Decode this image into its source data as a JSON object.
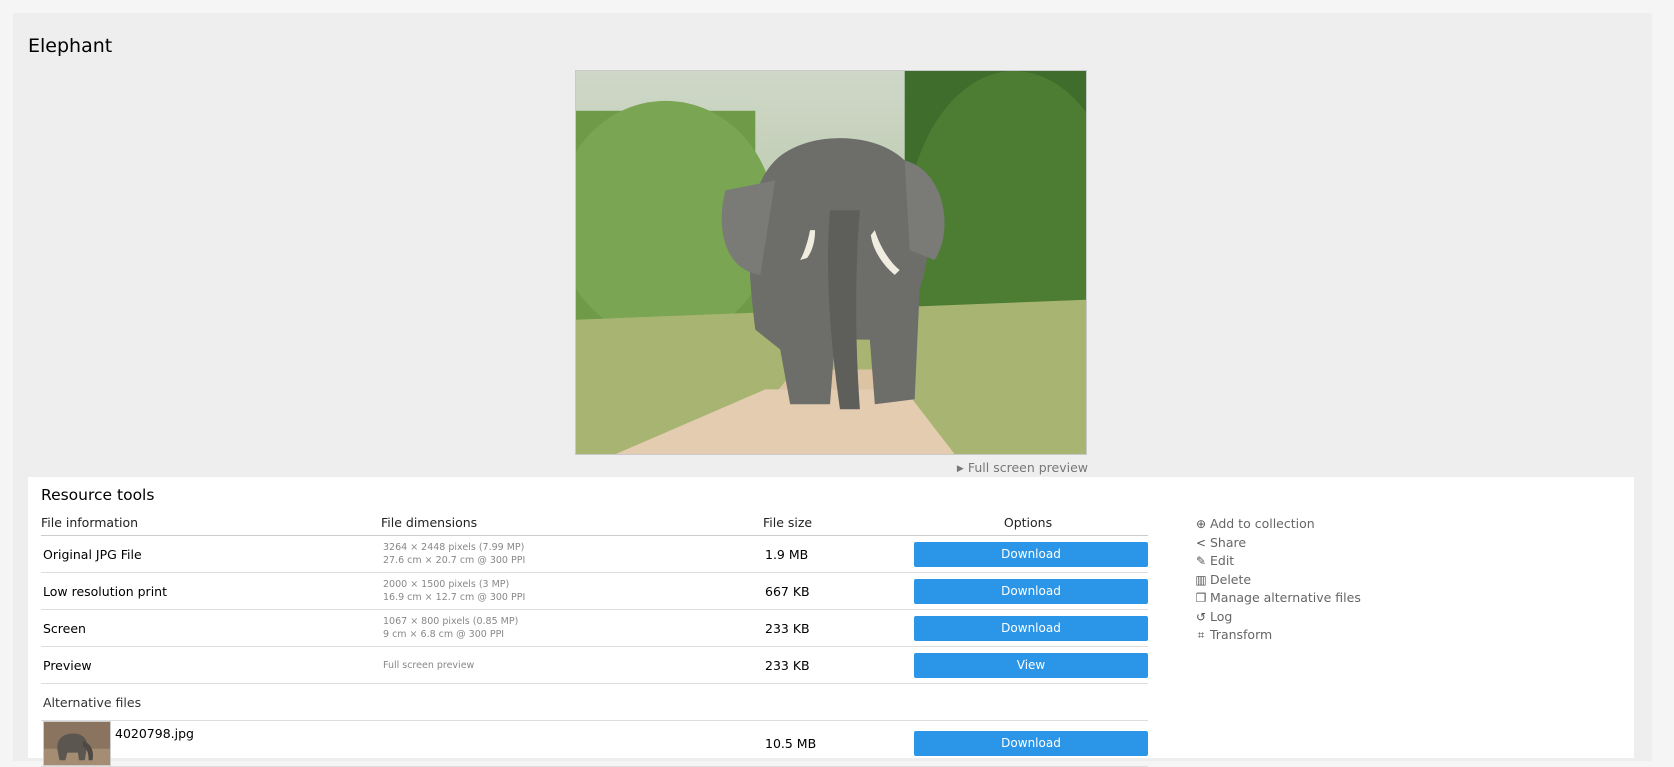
{
  "title": "Elephant",
  "preview": {
    "alt": "Elephant",
    "full_screen_label": "Full screen preview"
  },
  "resource_tools": {
    "heading": "Resource tools",
    "columns": [
      "File information",
      "File dimensions",
      "File size",
      "Options"
    ],
    "rows": [
      {
        "name": "Original JPG File",
        "dim1": "3264 × 2448 pixels (7.99 MP)",
        "dim2": "27.6 cm × 20.7 cm @ 300 PPI",
        "size": "1.9 MB",
        "action": "Download"
      },
      {
        "name": "Low resolution print",
        "dim1": "2000 × 1500 pixels (3 MP)",
        "dim2": "16.9 cm × 12.7 cm @ 300 PPI",
        "size": "667 KB",
        "action": "Download"
      },
      {
        "name": "Screen",
        "dim1": "1067 × 800 pixels (0.85 MP)",
        "dim2": "9 cm × 6.8 cm @ 300 PPI",
        "size": "233 KB",
        "action": "Download"
      },
      {
        "name": "Preview",
        "dim1": "Full screen preview",
        "dim2": "",
        "size": "233 KB",
        "action": "View"
      }
    ],
    "alternative_files_label": "Alternative files",
    "alternative_files": [
      {
        "name": "4020798.jpg",
        "size": "10.5 MB",
        "action": "Download"
      }
    ]
  },
  "side_actions": [
    {
      "icon": "plus-circle-icon",
      "label": "Add to collection"
    },
    {
      "icon": "share-icon",
      "label": "Share"
    },
    {
      "icon": "pencil-icon",
      "label": "Edit"
    },
    {
      "icon": "trash-icon",
      "label": "Delete"
    },
    {
      "icon": "copy-icon",
      "label": "Manage alternative files"
    },
    {
      "icon": "history-icon",
      "label": "Log"
    },
    {
      "icon": "crop-icon",
      "label": "Transform"
    }
  ],
  "colors": {
    "button": "#2b95e8",
    "panel": "#eeeeee"
  }
}
